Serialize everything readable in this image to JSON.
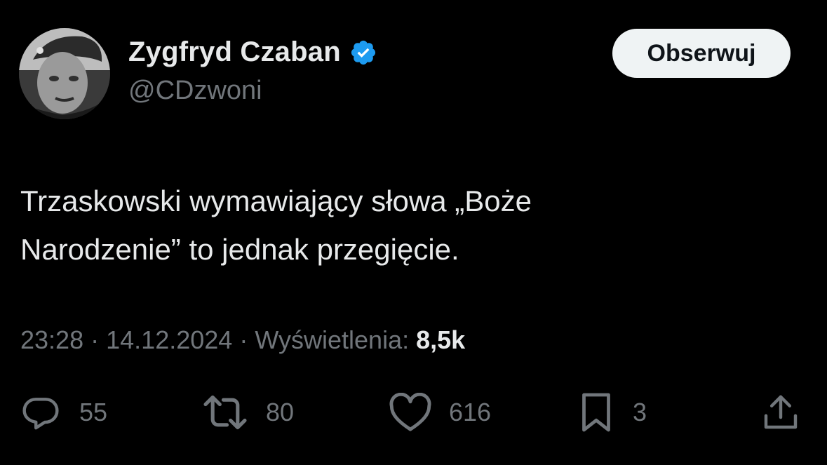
{
  "author": {
    "display_name": "Zygfryd Czaban",
    "handle": "@CDzwoni",
    "verified": true,
    "verified_color": "#1d9bf0"
  },
  "follow_button": {
    "label": "Obserwuj"
  },
  "tweet": {
    "lines": [
      "Trzaskowski wymawiający słowa „Boże",
      "Narodzenie” to jednak przegięcie."
    ]
  },
  "meta": {
    "time": "23:28",
    "separator": "·",
    "date": "14.12.2024",
    "views_label": "Wyświetlenia:",
    "views_count": "8,5k"
  },
  "actions": {
    "replies": {
      "icon": "reply-icon",
      "count": "55"
    },
    "reposts": {
      "icon": "repost-icon",
      "count": "80"
    },
    "likes": {
      "icon": "heart-icon",
      "count": "616"
    },
    "bookmarks": {
      "icon": "bookmark-icon",
      "count": "3"
    },
    "share": {
      "icon": "share-icon"
    }
  },
  "colors": {
    "background": "#000000",
    "primary_text": "#e7e9ea",
    "secondary_text": "#71767b",
    "button_bg": "#eff3f4",
    "button_text": "#0f1419"
  }
}
